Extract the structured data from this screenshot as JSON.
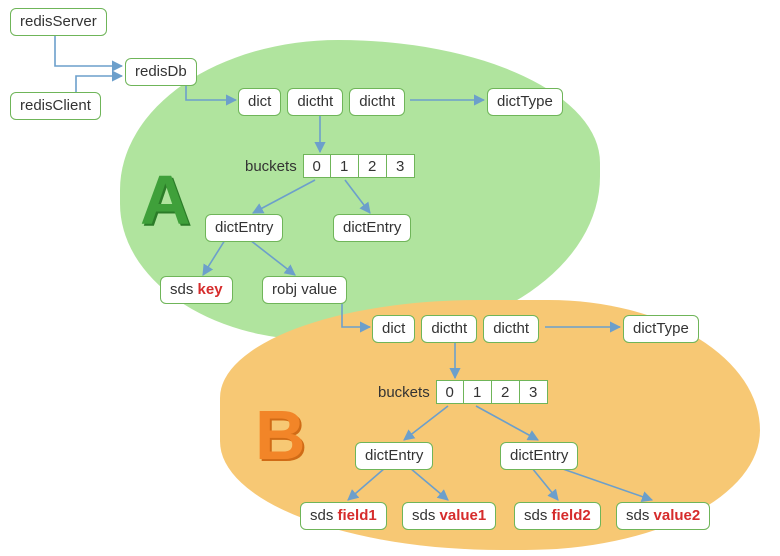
{
  "top": {
    "redisServer": "redisServer",
    "redisClient": "redisClient",
    "redisDb": "redisDb"
  },
  "sectionA": {
    "letter": "A",
    "dict": "dict",
    "dictht1": "dictht",
    "dictht2": "dictht",
    "dictType": "dictType",
    "bucketsLabel": "buckets",
    "buckets": [
      "0",
      "1",
      "2",
      "3"
    ],
    "entry1": "dictEntry",
    "entry2": "dictEntry",
    "sdsKey_prefix": "sds ",
    "sdsKey_key": "key",
    "robjValue_prefix": "robj ",
    "robjValue_val": "value"
  },
  "sectionB": {
    "letter": "B",
    "dict": "dict",
    "dictht1": "dictht",
    "dictht2": "dictht",
    "dictType": "dictType",
    "bucketsLabel": "buckets",
    "buckets": [
      "0",
      "1",
      "2",
      "3"
    ],
    "entry1": "dictEntry",
    "entry2": "dictEntry",
    "f1_pre": "sds ",
    "f1": "field1",
    "v1_pre": "sds ",
    "v1": "value1",
    "f2_pre": "sds ",
    "f2": "field2",
    "v2_pre": "sds ",
    "v2": "value2"
  }
}
